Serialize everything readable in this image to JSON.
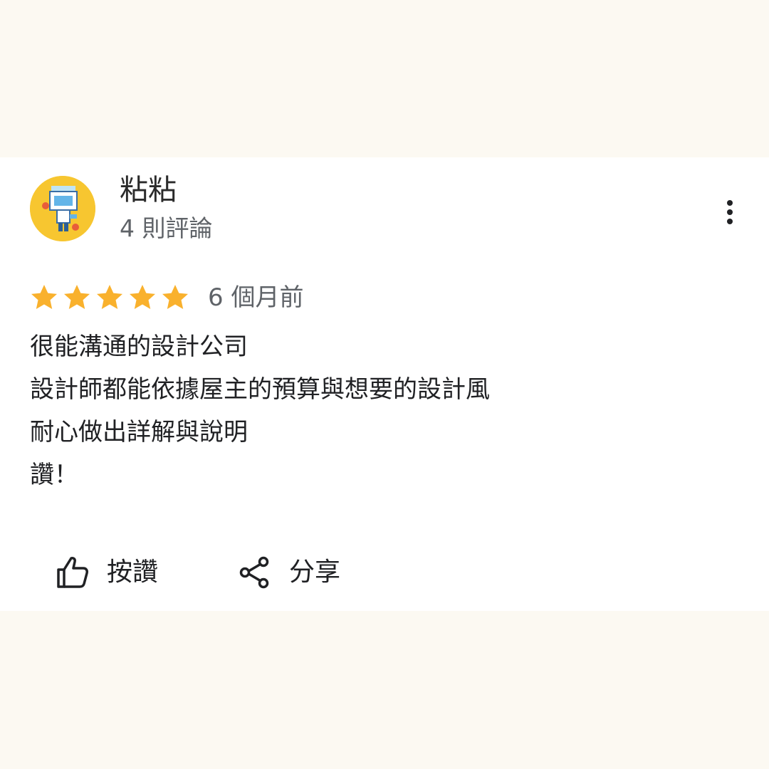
{
  "colors": {
    "page_background": "#fcf9f2",
    "card_background": "#ffffff",
    "star": "#f9b12d",
    "avatar_background": "#f7c630"
  },
  "review": {
    "reviewer": {
      "name": "粘粘",
      "review_count": "4 則評論",
      "avatar_icon": "cartoon-robot-avatar"
    },
    "more_options_icon": "more-vert-icon",
    "rating": {
      "stars": 5,
      "max": 5,
      "icon": "star-icon"
    },
    "date": "6 個月前",
    "text_lines": [
      "很能溝通的設計公司",
      "設計師都能依據屋主的預算與想要的設計風",
      "耐心做出詳解與說明",
      "讚！"
    ],
    "actions": {
      "like": {
        "label": "按讚",
        "icon": "thumbs-up-icon"
      },
      "share": {
        "label": "分享",
        "icon": "share-icon"
      }
    }
  }
}
